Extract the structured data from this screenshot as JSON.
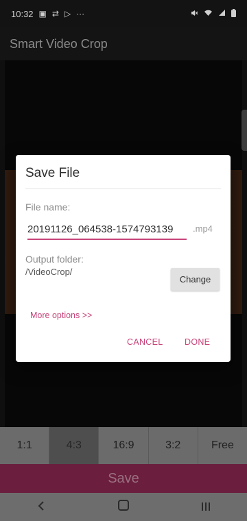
{
  "status_bar": {
    "time": "10:32",
    "left_icons": [
      "image-icon",
      "sync-icon",
      "play-store-icon",
      "more-dots-icon"
    ],
    "right_icons": [
      "mute-icon",
      "wifi-icon",
      "signal-icon",
      "battery-icon"
    ]
  },
  "app": {
    "title": "Smart Video Crop"
  },
  "ratio_options": [
    {
      "label": "1:1",
      "selected": false
    },
    {
      "label": "4:3",
      "selected": true
    },
    {
      "label": "16:9",
      "selected": false
    },
    {
      "label": "3:2",
      "selected": false
    },
    {
      "label": "Free",
      "selected": false
    }
  ],
  "save_bar": {
    "label": "Save"
  },
  "dialog": {
    "title": "Save File",
    "file_name_label": "File name:",
    "file_name_value": "20191126_064538-1574793139",
    "extension": ".mp4",
    "output_folder_label": "Output folder:",
    "output_folder_value": "/VideoCrop/",
    "change_button": "Change",
    "more_options": "More options >>",
    "cancel_button": "CANCEL",
    "done_button": "DONE"
  },
  "colors": {
    "accent": "#c8447a",
    "save_bar_dimmed": "#6b1e3d"
  }
}
